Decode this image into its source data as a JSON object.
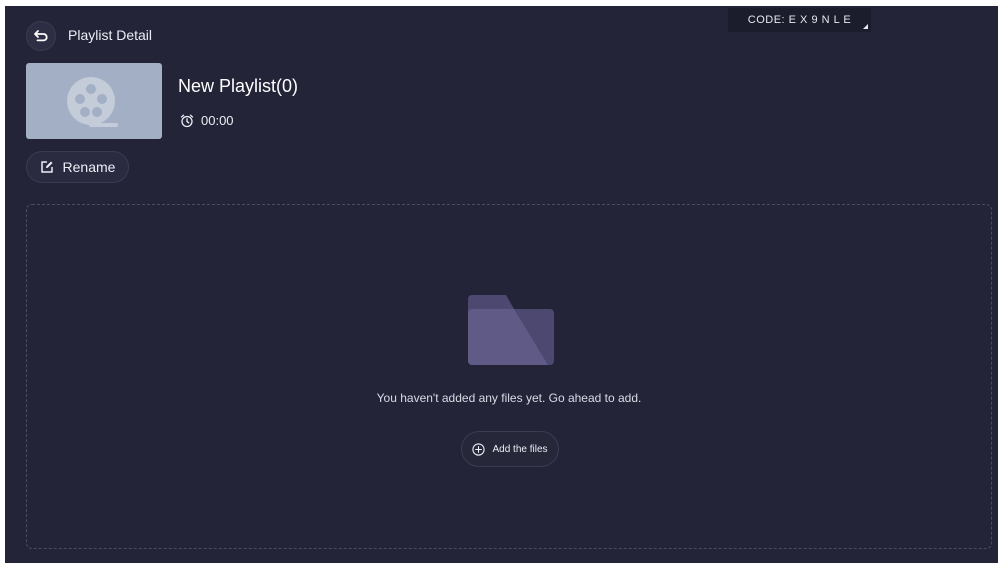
{
  "header": {
    "title": "Playlist Detail",
    "code": "CODE: E X 9 N L E"
  },
  "playlist": {
    "name": "New Playlist(0)",
    "duration": "00:00",
    "rename_label": "Rename"
  },
  "empty_state": {
    "message": "You haven't added any files yet. Go ahead to add.",
    "add_label": "Add the files"
  },
  "colors": {
    "background": "#232437",
    "thumbnail": "#a2afc4",
    "folder": "#5f5a86"
  },
  "icons": {
    "back": "back-arrow-icon",
    "thumbnail": "film-reel-icon",
    "duration": "alarm-clock-icon",
    "rename": "edit-icon",
    "empty": "folder-icon",
    "add": "plus-circle-icon"
  }
}
